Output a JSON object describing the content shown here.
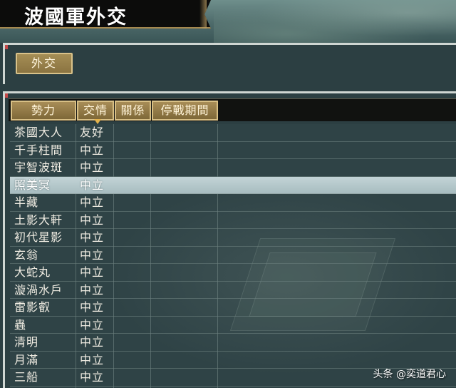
{
  "title": "波國軍外交",
  "tab_label": "外交",
  "columns": [
    "勢力",
    "交情",
    "關係",
    "停戰期間"
  ],
  "sorted_column": "交情",
  "rows": [
    {
      "faction": "茶國大人",
      "relation": "友好"
    },
    {
      "faction": "千手柱間",
      "relation": "中立"
    },
    {
      "faction": "宇智波斑",
      "relation": "中立"
    },
    {
      "faction": "照美冥",
      "relation": "中立",
      "selected": true
    },
    {
      "faction": "半藏",
      "relation": "中立"
    },
    {
      "faction": "土影大軒",
      "relation": "中立"
    },
    {
      "faction": "初代星影",
      "relation": "中立"
    },
    {
      "faction": "玄翁",
      "relation": "中立"
    },
    {
      "faction": "大蛇丸",
      "relation": "中立"
    },
    {
      "faction": "漩渦水戶",
      "relation": "中立"
    },
    {
      "faction": "雷影叡",
      "relation": "中立"
    },
    {
      "faction": "蟲",
      "relation": "中立"
    },
    {
      "faction": "清明",
      "relation": "中立"
    },
    {
      "faction": "月滿",
      "relation": "中立"
    },
    {
      "faction": "三船",
      "relation": "中立"
    }
  ],
  "watermark": "头条 @奕道君心",
  "colors": {
    "header_gold": "#a88d57",
    "selected_row": "#b5c8cc",
    "panel_bg": "#2f4346",
    "title_banner": "#0c0c0b"
  }
}
